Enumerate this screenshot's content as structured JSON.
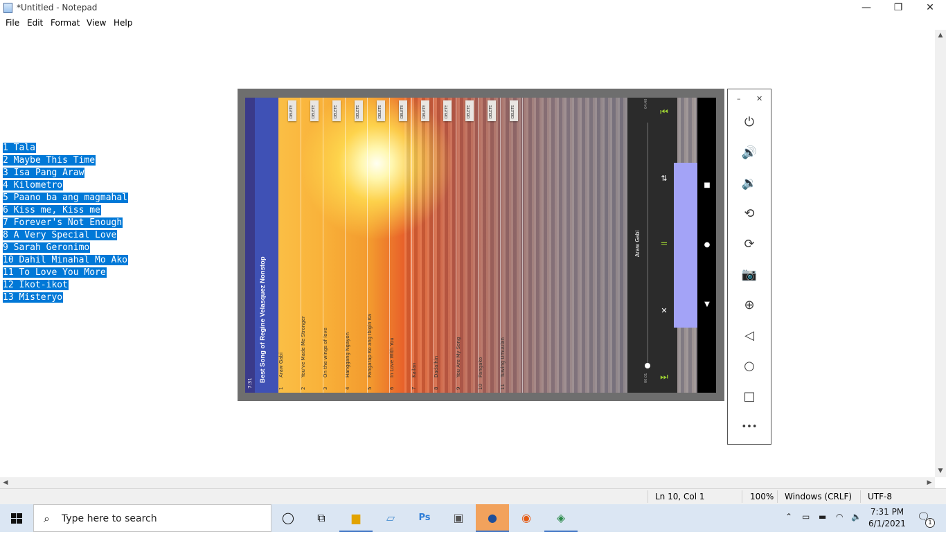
{
  "window": {
    "title": "*Untitled - Notepad",
    "minimize": "—",
    "maximize": "❐",
    "close": "✕"
  },
  "menu": [
    "File",
    "Edit",
    "Format",
    "View",
    "Help"
  ],
  "editor": {
    "lines": [
      "1 Tala",
      "2 Maybe This Time",
      "3 Isa Pang Araw",
      "4 Kilometro",
      "5 Paano ba ang magmahal",
      "6 Kiss me, Kiss me",
      "7 Forever's Not Enough",
      "8 A Very Special Love",
      "9 Sarah Geronimo",
      "10 Dahil Minahal Mo Ako",
      "11 To Love You More",
      "12 Ikot-ikot",
      "13 Misteryo"
    ]
  },
  "statusbar": {
    "position": "Ln 10, Col 1",
    "zoom": "100%",
    "line_ending": "Windows (CRLF)",
    "encoding": "UTF-8"
  },
  "emulator": {
    "status_time": "7:31",
    "app_title": "Best Song of Regine Velasquez Nonstop",
    "delete_label": "DELETE",
    "songs": [
      {
        "num": "1",
        "title": "Araw Gabi"
      },
      {
        "num": "2",
        "title": "You've Made Me Stronger"
      },
      {
        "num": "3",
        "title": "On the wings of love"
      },
      {
        "num": "4",
        "title": "Hanggang Ngayon"
      },
      {
        "num": "5",
        "title": "Pangarap Ko ang Ibigin Ka"
      },
      {
        "num": "6",
        "title": "In Love With You"
      },
      {
        "num": "7",
        "title": "Kailan"
      },
      {
        "num": "8",
        "title": "Dadalhin"
      },
      {
        "num": "9",
        "title": "You Are My Song"
      },
      {
        "num": "10",
        "title": "Pangako"
      },
      {
        "num": "11",
        "title": "Tuwing Umuulan"
      }
    ],
    "player": {
      "now_playing": "Araw Gabi",
      "current_time": "00:01",
      "total_time": "04:40",
      "progress": 0.0
    },
    "tools": {
      "minimize": "–",
      "close": "✕",
      "more": "•••"
    }
  },
  "taskbar": {
    "search_placeholder": "Type here to search",
    "time": "7:31 PM",
    "date": "6/1/2021",
    "notification_count": "1"
  }
}
